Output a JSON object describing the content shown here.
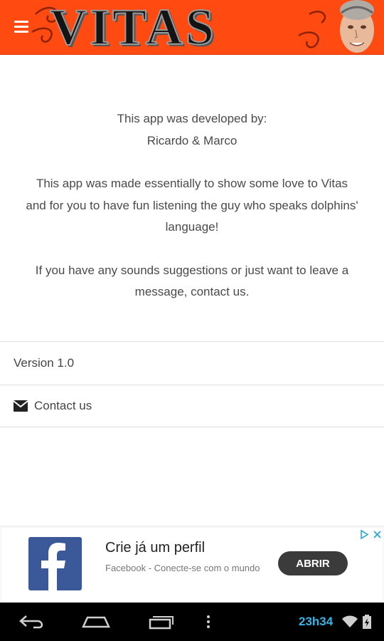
{
  "header": {
    "logo_text": "VITAS",
    "menu_icon": "hamburger-menu-icon",
    "background_color": "#ff4a12"
  },
  "about": {
    "developed_by_label": "This app was developed by:",
    "developers": "Ricardo & Marco",
    "purpose_line1": "This app was made essentially to show some love to Vitas",
    "purpose_line2": "and for you to have fun listening the guy who speaks dolphins'",
    "purpose_line3": "language!",
    "suggestion_line1": "If you have any sounds suggestions or just want to leave a",
    "suggestion_line2": "message, contact us."
  },
  "list": {
    "version_label": "Version 1.0",
    "contact_label": "Contact us",
    "contact_icon": "envelope-icon"
  },
  "ad": {
    "brand_icon": "facebook-logo-icon",
    "brand_color": "#3b5998",
    "title": "Crie já um perfil",
    "subtitle": "Facebook - Conecte-se com o mundo",
    "button_label": "ABRIR",
    "adchoices_icon": "adchoices-icon"
  },
  "system_bar": {
    "time": "23h34",
    "accent_color": "#33b5e5",
    "icons": [
      "back-icon",
      "home-icon",
      "recents-icon",
      "overflow-menu-icon",
      "wifi-icon",
      "battery-icon"
    ]
  }
}
